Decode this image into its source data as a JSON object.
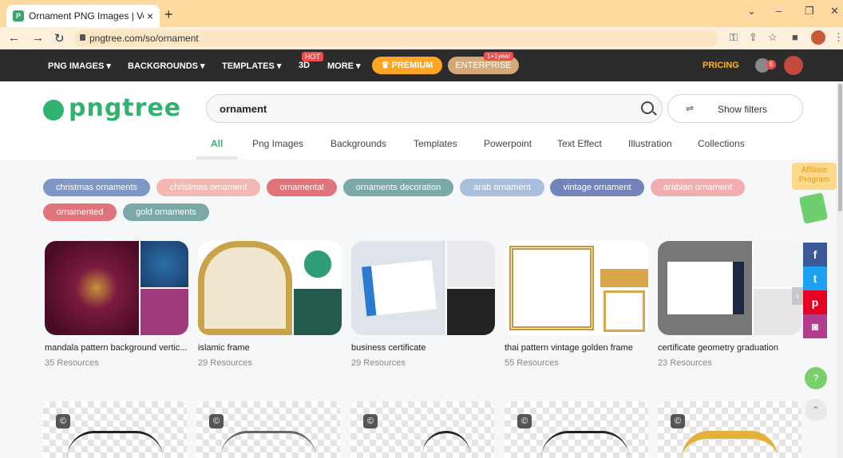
{
  "browser": {
    "tab_title": "Ornament PNG Images | Vector a",
    "url": "pngtree.com/so/ornament",
    "new_tab": "+",
    "close": "×"
  },
  "nav": {
    "png_images": "PNG IMAGES ▾",
    "backgrounds": "BACKGROUNDS ▾",
    "templates": "TEMPLATES ▾",
    "three_d": "3D",
    "hot_badge": "HOT",
    "more": "MORE ▾",
    "premium": "♛ PREMIUM",
    "enterprise": "ENTERPRISE",
    "enterprise_badge": "1+1year",
    "pricing": "PRICING",
    "notification_count": "6"
  },
  "logo": "pngtree",
  "search": {
    "value": "ornament",
    "filters_label": "Show filters"
  },
  "category_tabs": [
    "All",
    "Png Images",
    "Backgrounds",
    "Templates",
    "Powerpoint",
    "Text Effect",
    "Illustration",
    "Collections"
  ],
  "chips": [
    {
      "label": "christmas ornaments",
      "color": "#7f97c5"
    },
    {
      "label": "christmas ornament",
      "color": "#f2b9b3"
    },
    {
      "label": "ornamental",
      "color": "#e0747b"
    },
    {
      "label": "ornaments decoration",
      "color": "#7aa9a7"
    },
    {
      "label": "arab ornament",
      "color": "#a9bddc"
    },
    {
      "label": "vintage ornament",
      "color": "#7384bb"
    },
    {
      "label": "arabian ornament",
      "color": "#f2aeae"
    },
    {
      "label": "ornamented",
      "color": "#e0747b"
    },
    {
      "label": "gold ornaments",
      "color": "#7aa9a7"
    }
  ],
  "affiliate": "Affiliate Program",
  "social": {
    "facebook": "f",
    "twitter": "t",
    "pinterest": "p",
    "instagram": "◙"
  },
  "collections": [
    {
      "title": "mandala pattern background vertic...",
      "count": "35 Resources"
    },
    {
      "title": "islamic frame",
      "count": "29 Resources"
    },
    {
      "title": "business certificate",
      "count": "29 Resources"
    },
    {
      "title": "thai pattern vintage golden frame",
      "count": "55 Resources"
    },
    {
      "title": "certificate geometry graduation",
      "count": "23 Resources"
    }
  ],
  "colors": {
    "brand": "#2fb36f",
    "nav_bg": "#2d2c2c",
    "premium": "#ffa524",
    "pricing": "#ffb21e"
  }
}
